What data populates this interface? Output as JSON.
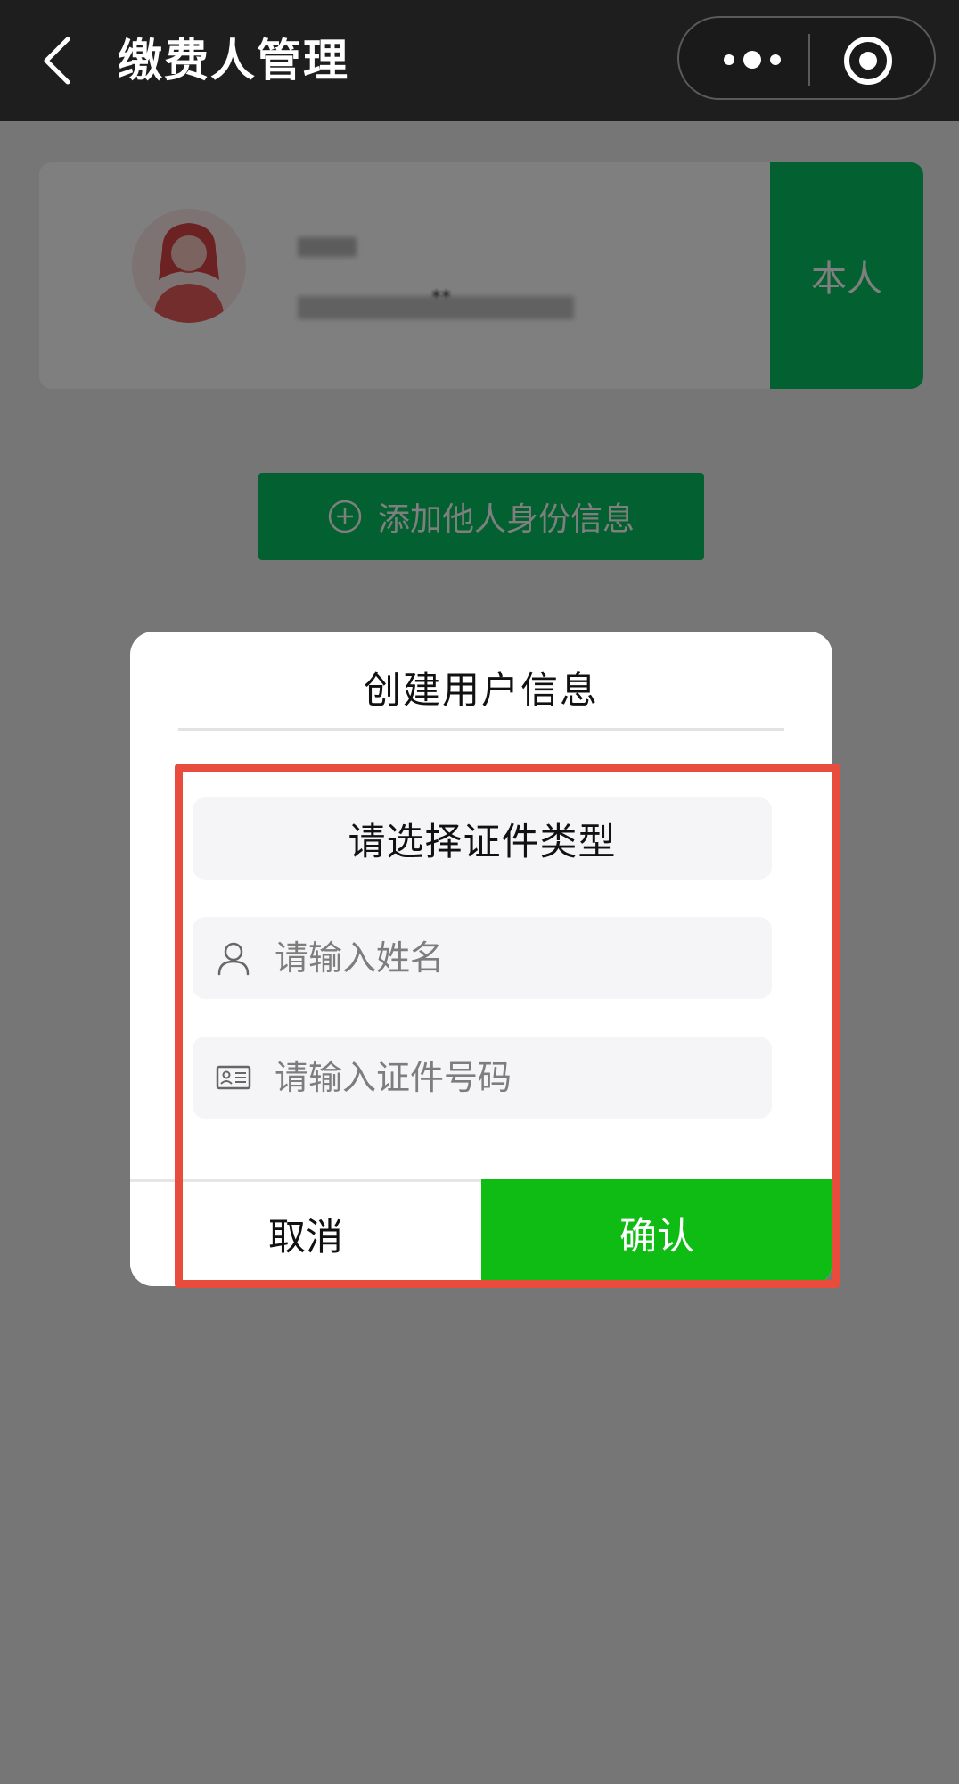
{
  "navbar": {
    "title": "缴费人管理",
    "back_icon": "chevron-left-icon",
    "more_icon": "more-dots-icon",
    "home_icon": "target-circle-icon"
  },
  "profile": {
    "name": "",
    "id_number": "**",
    "tag": "本人",
    "avatar_icon": "female-avatar-icon"
  },
  "add_button": {
    "label": "添加他人身份信息",
    "icon": "plus-circle-icon"
  },
  "dialog": {
    "title": "创建用户信息",
    "id_type_select": {
      "label": "请选择证件类型"
    },
    "name_field": {
      "placeholder": "请输入姓名",
      "value": "",
      "icon": "user-icon"
    },
    "id_field": {
      "placeholder": "请输入证件号码",
      "value": "",
      "icon": "id-card-icon"
    },
    "cancel_label": "取消",
    "confirm_label": "确认"
  },
  "colors": {
    "navbar_bg": "#1e1e1e",
    "brand_green": "#07c160",
    "confirm_green": "#0fbc14",
    "highlight_red": "#e74c3c",
    "field_bg": "#f5f5f7"
  }
}
